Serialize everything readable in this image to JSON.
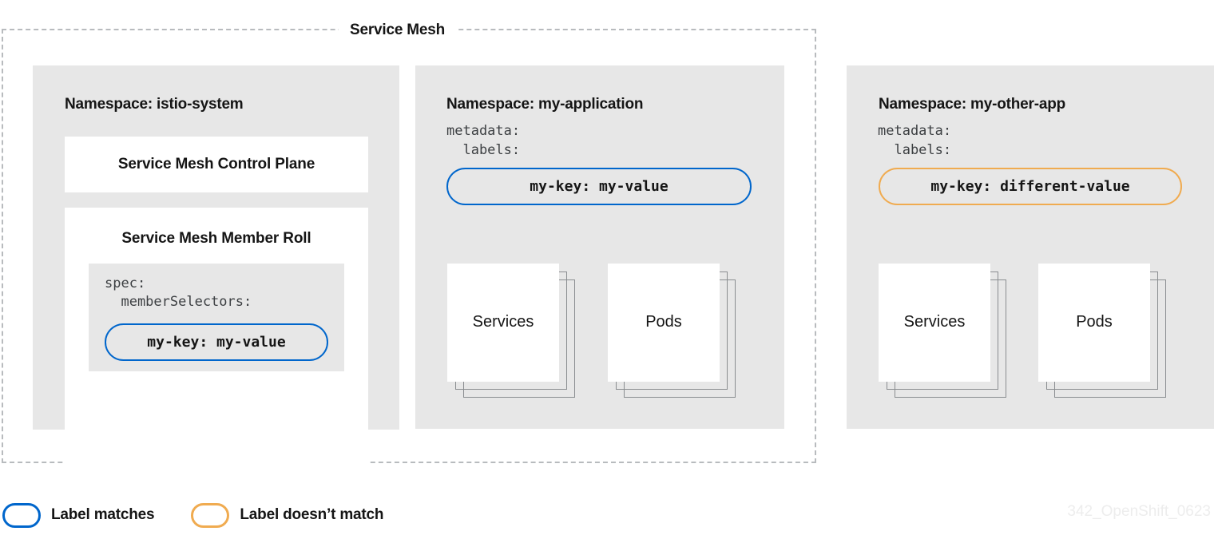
{
  "diagram": {
    "boundary_label": "Service Mesh",
    "watermark": "342_OpenShift_0623"
  },
  "namespaces": [
    {
      "title": "Namespace: istio-system",
      "cards": [
        {
          "heading": "Service Mesh Control Plane"
        },
        {
          "heading": "Service Mesh Member Roll",
          "code": {
            "line1": "spec:",
            "line2": "  memberSelectors:",
            "pill": {
              "text": "my-key: my-value",
              "state": "matches",
              "color": "#0066cc"
            }
          }
        }
      ]
    },
    {
      "title": "Namespace: my-application",
      "yaml": {
        "line1": "metadata:",
        "line2": "  labels:"
      },
      "pill": {
        "text": "my-key: my-value",
        "state": "matches",
        "color": "#0066cc"
      },
      "resources": [
        {
          "label": "Services"
        },
        {
          "label": "Pods"
        }
      ]
    },
    {
      "title": "Namespace: my-other-app",
      "yaml": {
        "line1": "metadata:",
        "line2": "  labels:"
      },
      "pill": {
        "text": "my-key: different-value",
        "state": "does-not-match",
        "color": "#f0ab50"
      },
      "resources": [
        {
          "label": "Services"
        },
        {
          "label": "Pods"
        }
      ]
    }
  ],
  "legend": {
    "items": [
      {
        "label": "Label matches",
        "color": "#0066cc"
      },
      {
        "label": "Label doesn’t match",
        "color": "#f0ab50"
      }
    ]
  }
}
